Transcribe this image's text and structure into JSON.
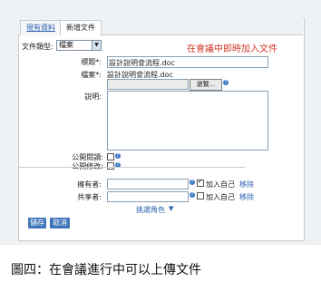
{
  "tabs": [
    {
      "label": "現有資料"
    },
    {
      "label": "新增文件"
    }
  ],
  "form": {
    "doc_type_label": "文件類型:",
    "doc_type_value": "檔案",
    "note": "在會議中即時加入文件",
    "title_label": "標題*:",
    "title_value": "設計說明會流程.doc",
    "file_label": "檔案*:",
    "file_name": "設計說明會流程.doc",
    "browse_label": "瀏覽...",
    "description_label": "說明:",
    "public_read_label": "公開閱讀:",
    "public_edit_label": "公開修改:",
    "owner_label": "擁有者:",
    "cosigner_label": "共享者:",
    "add_self_label": "加入自己",
    "remove_label": "移除",
    "pick_role_label": "挑選角色",
    "save_label": "儲存",
    "cancel_label": "取消"
  },
  "caption": "圖四：在會議進行中可以上傳文件",
  "colors": {
    "accent": "#3e74b9",
    "note": "#d23b2a",
    "link": "#2b5fb0"
  }
}
